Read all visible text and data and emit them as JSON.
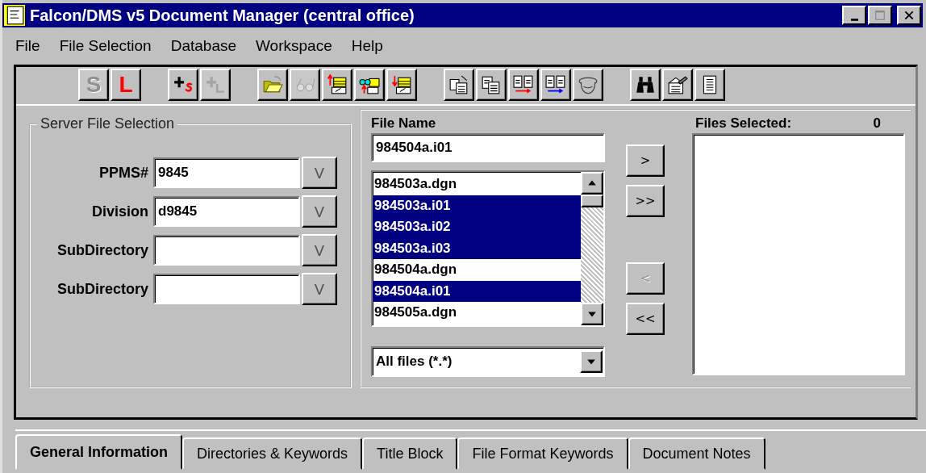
{
  "window": {
    "title": "Falcon/DMS v5 Document Manager (central office)"
  },
  "menu": [
    {
      "label": "File"
    },
    {
      "label": "File Selection"
    },
    {
      "label": "Database"
    },
    {
      "label": "Workspace"
    },
    {
      "label": "Help"
    }
  ],
  "toolbar": [
    [
      {
        "kind": "letter",
        "text": "S",
        "disabled": true
      },
      {
        "kind": "letter",
        "text": "L",
        "disabled": false
      }
    ],
    [
      {
        "kind": "plus-s",
        "disabled": false
      },
      {
        "kind": "plus-l",
        "disabled": true
      }
    ],
    [
      {
        "kind": "folder-open",
        "disabled": false
      },
      {
        "kind": "glasses",
        "disabled": true
      },
      {
        "kind": "folder-up",
        "disabled": false
      },
      {
        "kind": "glasses-folder",
        "disabled": false
      },
      {
        "kind": "folder-down",
        "disabled": false
      }
    ],
    [
      {
        "kind": "doc-export",
        "disabled": false
      },
      {
        "kind": "docs-copy",
        "disabled": false
      },
      {
        "kind": "docs-compare",
        "disabled": false
      },
      {
        "kind": "docs-ab",
        "disabled": false
      },
      {
        "kind": "helmet",
        "disabled": false
      }
    ],
    [
      {
        "kind": "binoculars",
        "disabled": false
      },
      {
        "kind": "folder-edit",
        "disabled": false
      },
      {
        "kind": "list",
        "disabled": false
      }
    ]
  ],
  "server_file_selection": {
    "title": "Server File Selection",
    "fields": [
      {
        "label": "PPMS#",
        "value": "9845",
        "button": "V"
      },
      {
        "label": "Division",
        "value": "d9845",
        "button": "V"
      },
      {
        "label": "SubDirectory",
        "button": "V"
      },
      {
        "label": "SubDirectory",
        "button": "V"
      }
    ]
  },
  "file_name": {
    "label": "File Name",
    "value": "984504a.i01"
  },
  "file_list": {
    "items": [
      {
        "name": "984503a.dgn",
        "selected": false
      },
      {
        "name": "984503a.i01",
        "selected": true
      },
      {
        "name": "984503a.i02",
        "selected": true
      },
      {
        "name": "984503a.i03",
        "selected": true
      },
      {
        "name": "984504a.dgn",
        "selected": false
      },
      {
        "name": "984504a.i01",
        "selected": true
      },
      {
        "name": "984505a.dgn",
        "selected": false
      }
    ]
  },
  "filter": {
    "value": "All files (*.*)"
  },
  "transfer_buttons": [
    {
      "label": ">",
      "disabled": false
    },
    {
      "label": ">>",
      "disabled": false
    },
    {
      "label": "<",
      "disabled": true
    },
    {
      "label": "<<",
      "disabled": false
    }
  ],
  "files_selected": {
    "label": "Files Selected:",
    "count": "0"
  },
  "tabs": [
    {
      "label": "General Information",
      "selected": true
    },
    {
      "label": "Directories & Keywords",
      "selected": false
    },
    {
      "label": "Title Block",
      "selected": false
    },
    {
      "label": "File Format Keywords",
      "selected": false
    },
    {
      "label": "Document Notes",
      "selected": false
    }
  ]
}
